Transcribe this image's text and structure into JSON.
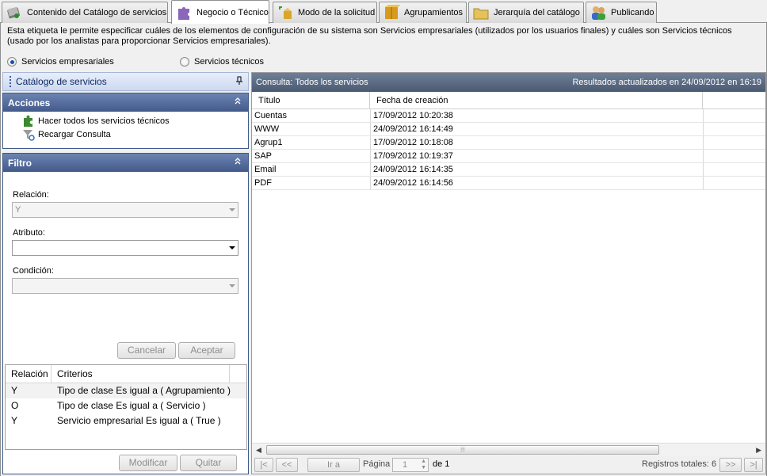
{
  "tabs": [
    {
      "label": "Contenido del Catálogo de servicios",
      "icon": "catalog-book-icon",
      "active": false
    },
    {
      "label": "Negocio o Técnico",
      "icon": "puzzle-piece-icon",
      "active": true
    },
    {
      "label": "Modo de la solicitud",
      "icon": "request-mode-icon",
      "active": false
    },
    {
      "label": "Agrupamientos",
      "icon": "boxes-icon",
      "active": false
    },
    {
      "label": "Jerarquía del catálogo",
      "icon": "folder-icon",
      "active": false
    },
    {
      "label": "Publicando",
      "icon": "users-icon",
      "active": false
    }
  ],
  "description": "Esta etiqueta le permite especificar cuáles de los elementos de configuración de su sistema son Servicios empresariales (utilizados por los usuarios finales) y cuáles son Servicios técnicos (usado por los analistas para proporcionar Servicios empresariales).",
  "radios": {
    "business": "Servicios empresariales",
    "technical": "Servicios técnicos",
    "selected": "business"
  },
  "left_panel": {
    "title": "Catálogo de servicios",
    "actions": {
      "title": "Acciones",
      "items": [
        "Hacer todos los servicios técnicos",
        "Recargar Consulta"
      ]
    },
    "filter": {
      "title": "Filtro",
      "relation_label": "Relación:",
      "relation_value": "Y",
      "attribute_label": "Atributo:",
      "attribute_value": "",
      "condition_label": "Condición:",
      "condition_value": "",
      "cancel": "Cancelar",
      "accept": "Aceptar",
      "grid_headers": [
        "Relación",
        "Criterios"
      ],
      "grid_rows": [
        {
          "rel": "Y",
          "crit": "Tipo de clase Es igual a ( Agrupamiento )"
        },
        {
          "rel": "O",
          "crit": "Tipo de clase Es igual a ( Servicio )"
        },
        {
          "rel": "Y",
          "crit": "Servicio empresarial Es igual a ( True )"
        }
      ],
      "modify": "Modificar",
      "remove": "Quitar"
    }
  },
  "right_panel": {
    "query_title": "Consulta: Todos los servicios",
    "updated": "Resultados actualizados en 24/09/2012 en 16:19",
    "headers": [
      "Título",
      "Fecha de creación"
    ],
    "rows": [
      {
        "title": "Cuentas",
        "date": "17/09/2012 10:20:38"
      },
      {
        "title": "WWW",
        "date": "24/09/2012 16:14:49"
      },
      {
        "title": "Agrup1",
        "date": "17/09/2012 10:18:08"
      },
      {
        "title": "SAP",
        "date": "17/09/2012 10:19:37"
      },
      {
        "title": "Email",
        "date": "24/09/2012 16:14:35"
      },
      {
        "title": "PDF",
        "date": "24/09/2012 16:14:56"
      }
    ],
    "pager": {
      "first": "|<",
      "prev": "<<",
      "goto": "Ir a",
      "page_label": "Página",
      "page_value": "1",
      "of_label": "de 1",
      "total": "Registros totales: 6",
      "next": ">>",
      "last": ">|"
    }
  }
}
